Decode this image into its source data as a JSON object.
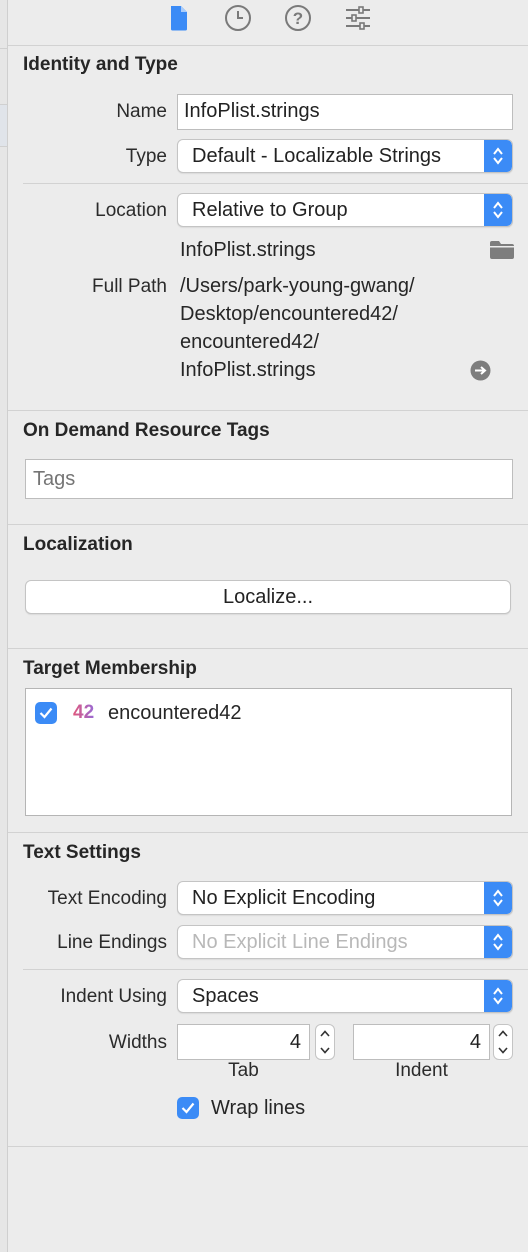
{
  "toolbar": {
    "icons": [
      "file-inspector-icon",
      "history-icon",
      "quick-help-icon",
      "attributes-inspector-icon"
    ]
  },
  "identity": {
    "title": "Identity and Type",
    "name_label": "Name",
    "name_value": "InfoPlist.strings",
    "type_label": "Type",
    "type_value": "Default - Localizable Strings",
    "location_label": "Location",
    "location_value": "Relative to Group",
    "file_name": "InfoPlist.strings",
    "full_path_label": "Full Path",
    "full_path_lines": [
      "/Users/park-young-gwang/",
      "Desktop/encountered42/",
      "encountered42/",
      "InfoPlist.strings"
    ]
  },
  "on_demand": {
    "title": "On Demand Resource Tags",
    "tags_placeholder": "Tags"
  },
  "localization": {
    "title": "Localization",
    "button_label": "Localize..."
  },
  "target_membership": {
    "title": "Target Membership",
    "targets": [
      {
        "badge": "42",
        "name": "encountered42",
        "checked": true
      }
    ]
  },
  "text_settings": {
    "title": "Text Settings",
    "encoding_label": "Text Encoding",
    "encoding_value": "No Explicit Encoding",
    "line_endings_label": "Line Endings",
    "line_endings_value": "No Explicit Line Endings",
    "indent_using_label": "Indent Using",
    "indent_using_value": "Spaces",
    "widths_label": "Widths",
    "tab_value": "4",
    "tab_caption": "Tab",
    "indent_value": "4",
    "indent_caption": "Indent",
    "wrap_lines_label": "Wrap lines",
    "wrap_lines_checked": true
  },
  "colors": {
    "accent": "#3b8bf6",
    "background": "#ececec"
  }
}
